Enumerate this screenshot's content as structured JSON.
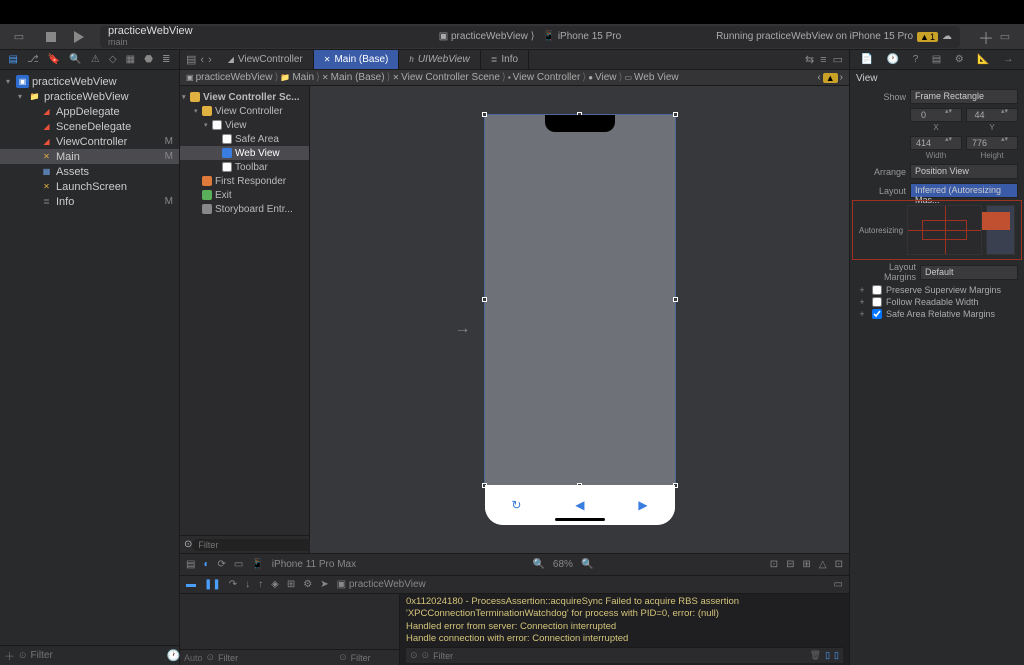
{
  "toolbar": {
    "project_name": "practiceWebView",
    "branch": "main",
    "scheme": "practiceWebView",
    "destination": "iPhone 15 Pro",
    "status": "Running practiceWebView on iPhone 15 Pro",
    "warnings": "1"
  },
  "navigator": {
    "tree": [
      {
        "label": "practiceWebView",
        "depth": 0,
        "icon": "proj",
        "disclosure": "▾"
      },
      {
        "label": "practiceWebView",
        "depth": 1,
        "icon": "folder",
        "disclosure": "▾"
      },
      {
        "label": "AppDelegate",
        "depth": 2,
        "icon": "swift"
      },
      {
        "label": "SceneDelegate",
        "depth": 2,
        "icon": "swift"
      },
      {
        "label": "ViewController",
        "depth": 2,
        "icon": "swift",
        "mod": "M"
      },
      {
        "label": "Main",
        "depth": 2,
        "icon": "sb",
        "mod": "M",
        "selected": true
      },
      {
        "label": "Assets",
        "depth": 2,
        "icon": "assets"
      },
      {
        "label": "LaunchScreen",
        "depth": 2,
        "icon": "sb"
      },
      {
        "label": "Info",
        "depth": 2,
        "icon": "plist",
        "mod": "M"
      }
    ],
    "filter_placeholder": "Filter"
  },
  "tabs": [
    {
      "label": "ViewController",
      "icon": "swift"
    },
    {
      "label": "Main (Base)",
      "icon": "sb",
      "active": true
    },
    {
      "label": "UIWebView",
      "icon": "h",
      "italic": true
    },
    {
      "label": "Info",
      "icon": "plist"
    }
  ],
  "breadcrumb": [
    "practiceWebView",
    "Main",
    "Main (Base)",
    "View Controller Scene",
    "View Controller",
    "View",
    "Web View"
  ],
  "outline": {
    "header": "View Controller Sc...",
    "items": [
      {
        "label": "View Controller",
        "depth": 0,
        "icon": "vc",
        "disc": "▾"
      },
      {
        "label": "View",
        "depth": 1,
        "icon": "view",
        "disc": "▾"
      },
      {
        "label": "Safe Area",
        "depth": 2,
        "icon": "view"
      },
      {
        "label": "Web View",
        "depth": 2,
        "icon": "web",
        "selected": true
      },
      {
        "label": "Toolbar",
        "depth": 2
      },
      {
        "label": "First Responder",
        "depth": 0,
        "icon": "fr"
      },
      {
        "label": "Exit",
        "depth": 0,
        "icon": "exit"
      },
      {
        "label": "Storyboard Entr...",
        "depth": 0,
        "icon": "sb"
      }
    ],
    "filter_placeholder": "Filter"
  },
  "canvas": {
    "device": "iPhone 11 Pro Max",
    "zoom": "68%"
  },
  "debug": {
    "target": "practiceWebView",
    "auto_label": "Auto",
    "filter_placeholder": "Filter",
    "console_lines": [
      "0x112024180 - ProcessAssertion::acquireSync Failed to acquire RBS assertion 'XPCConnectionTerminationWatchdog' for process with PID=0, error: (null)",
      "Handled error from server: Connection interrupted",
      "Handle connection with error: Connection interrupted"
    ]
  },
  "inspector": {
    "title": "View",
    "show_label": "Show",
    "show_value": "Frame Rectangle",
    "x": {
      "value": "0",
      "label": "X"
    },
    "y": {
      "value": "44",
      "label": "Y"
    },
    "width": {
      "value": "414",
      "label": "Width"
    },
    "height": {
      "value": "776",
      "label": "Height"
    },
    "arrange_label": "Arrange",
    "arrange_value": "Position View",
    "layout_label": "Layout",
    "layout_value": "Inferred (Autoresizing Mas...",
    "autoresizing_label": "Autoresizing",
    "margins_label": "Layout Margins",
    "margins_value": "Default",
    "check1": "Preserve Superview Margins",
    "check2": "Follow Readable Width",
    "check3": "Safe Area Relative Margins"
  }
}
